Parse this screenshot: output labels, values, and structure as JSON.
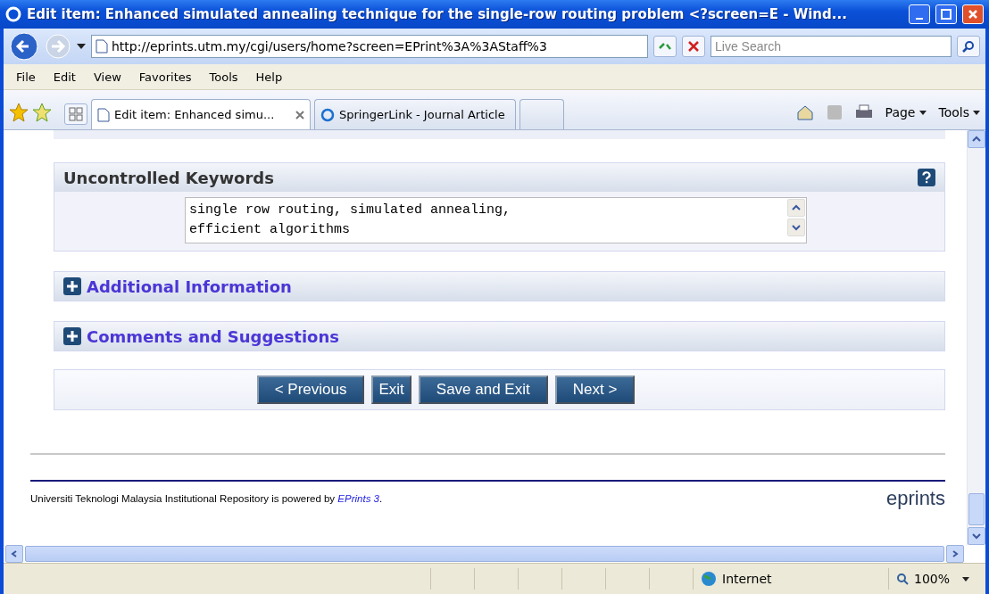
{
  "window": {
    "title": "Edit item: Enhanced simulated annealing technique for the single-row routing problem <?screen=E - Wind..."
  },
  "address_bar": {
    "value": "http://eprints.utm.my/cgi/users/home?screen=EPrint%3A%3AStaff%3",
    "search_placeholder": "Live Search"
  },
  "menu": [
    "File",
    "Edit",
    "View",
    "Favorites",
    "Tools",
    "Help"
  ],
  "tabs": [
    {
      "label": "Edit item: Enhanced simu...",
      "selected": true
    },
    {
      "label": "SpringerLink - Journal Article",
      "selected": false
    }
  ],
  "command_bar": [
    "Page",
    "Tools"
  ],
  "sections": [
    {
      "kind": "open",
      "title": "Uncontrolled Keywords",
      "value": "single row routing, simulated annealing, efficient algorithms"
    },
    {
      "kind": "collapsed",
      "title": "Additional Information"
    },
    {
      "kind": "collapsed",
      "title": "Comments and Suggestions"
    }
  ],
  "buttons": [
    "< Previous",
    "Exit",
    "Save and Exit",
    "Next >"
  ],
  "footer": {
    "text": "Universiti Teknologi Malaysia Institutional Repository is powered by ",
    "link": "EPrints 3",
    "after": ".",
    "logo": "eprints"
  },
  "status_bar": {
    "zone": "Internet",
    "zoom": "100%"
  }
}
